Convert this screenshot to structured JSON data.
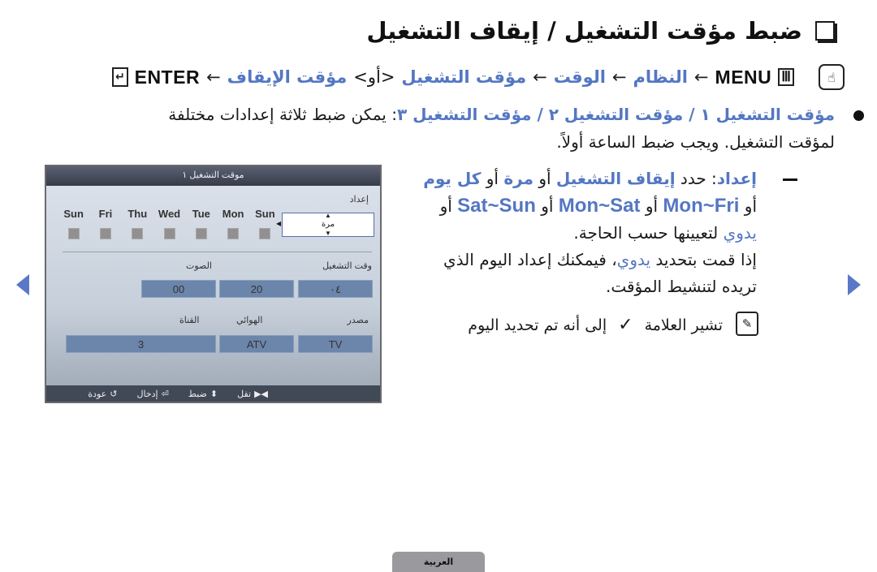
{
  "title": {
    "text": "ضبط مؤقت التشغيل / إيقاف التشغيل",
    "checkbox_icon": "square-checkbox-icon"
  },
  "menu_path": {
    "hand_icon": "hand-touch-icon",
    "menu_key": "MENU",
    "menu_icon": "menu-grid-icon",
    "arrow": "←",
    "steps": [
      "النظام",
      "الوقت",
      "مؤقت التشغيل",
      "<أو>",
      "مؤقت الإيقاف"
    ],
    "enter_key": "ENTER",
    "enter_icon": "enter-key-icon"
  },
  "bullet": {
    "highlight": "مؤقت التشغيل ١ / مؤقت التشغيل ٢ / مؤقت التشغيل ٣",
    "text": ": يمكن ضبط ثلاثة إعدادات مختلفة لمؤقت التشغيل. ويجب ضبط الساعة أولاً."
  },
  "setup": {
    "label": "إعداد",
    "t1": ": حدد ",
    "opt_off": "إيقاف التشغيل",
    "or": " أو ",
    "opt_once": "مرة",
    "opt_daily": "كل يوم",
    "opt_monfri": "Mon~Fri",
    "opt_monsat": "Mon~Sat",
    "opt_satsun": "Sat~Sun",
    "opt_manual": "يدوي",
    "t2": " لتعيينها حسب الحاجة.",
    "t3": "إذا قمت بتحديد ",
    "t4": "، فيمكنك إعداد اليوم الذي تريده لتنشيط المؤقت."
  },
  "note": {
    "icon": "note-pencil-icon",
    "text_before": "تشير العلامة",
    "check_icon": "checkmark-icon",
    "text_after": "إلى أنه تم تحديد اليوم"
  },
  "nav": {
    "prev_icon": "left-triangle-icon",
    "next_icon": "right-triangle-icon"
  },
  "osd": {
    "header": "موقت التشغيل ١",
    "setup_label": "إعداد",
    "days": [
      "Sun",
      "Fri",
      "Thu",
      "Wed",
      "Tue",
      "Mon",
      "Sun"
    ],
    "repeat_value": "مرة",
    "on_time_label": "وقت التشغيل",
    "volume_label": "الصوت",
    "hour_value": "٠٤",
    "minute_value": "20",
    "volume_value": "00",
    "source_label": "مصدر",
    "antenna_label": "الهوائي",
    "channel_label": "القناة",
    "source_value": "TV",
    "antenna_value": "ATV",
    "channel_value": "3",
    "footer": {
      "move": "تقل",
      "adjust": "ضبط",
      "enter": "إدخال",
      "return": "عودة"
    }
  },
  "language_tab": "العربية"
}
